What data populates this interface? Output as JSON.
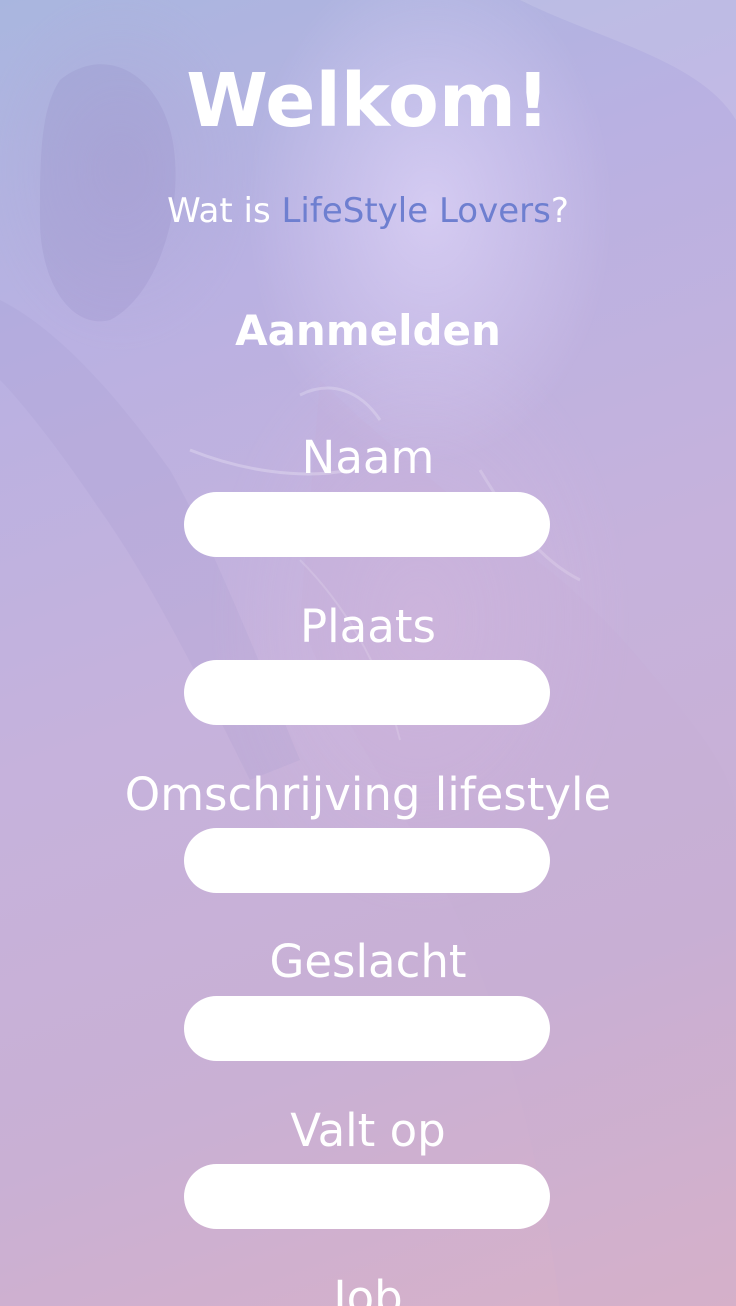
{
  "header": {
    "title": "Welkom!",
    "subtitle_prefix": "Wat is ",
    "subtitle_brand": "LifeStyle Lovers",
    "subtitle_suffix": "?"
  },
  "form": {
    "heading": "Aanmelden",
    "fields": [
      {
        "label": "Naam",
        "value": ""
      },
      {
        "label": "Plaats",
        "value": ""
      },
      {
        "label": "Omschrijving lifestyle",
        "value": ""
      },
      {
        "label": "Geslacht",
        "value": ""
      },
      {
        "label": "Valt op",
        "value": ""
      },
      {
        "label": "Job"
      }
    ]
  },
  "colors": {
    "brand_link": "#6e7fd0",
    "text": "#ffffff",
    "input_background": "#ffffff"
  }
}
